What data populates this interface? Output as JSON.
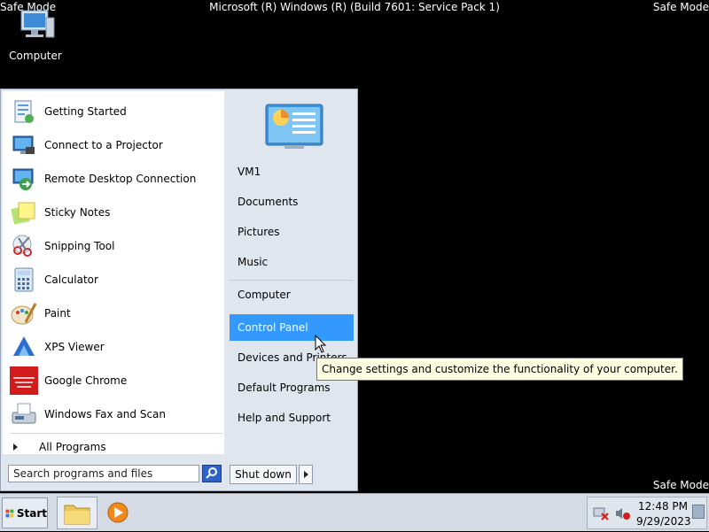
{
  "banner": {
    "top_left": "Safe Mode",
    "top_right": "Safe Mode",
    "bottom_right": "Safe Mode",
    "build": "Microsoft (R) Windows (R) (Build 7601: Service Pack 1)"
  },
  "desktop": {
    "computer_label": "Computer"
  },
  "start_menu": {
    "programs": [
      {
        "label": "Getting Started",
        "icon": "getting-started-icon"
      },
      {
        "label": "Connect to a Projector",
        "icon": "projector-icon"
      },
      {
        "label": "Remote Desktop Connection",
        "icon": "remote-desktop-icon"
      },
      {
        "label": "Sticky Notes",
        "icon": "sticky-notes-icon"
      },
      {
        "label": "Snipping Tool",
        "icon": "snipping-tool-icon"
      },
      {
        "label": "Calculator",
        "icon": "calculator-icon"
      },
      {
        "label": "Paint",
        "icon": "paint-icon"
      },
      {
        "label": "XPS Viewer",
        "icon": "xps-viewer-icon"
      },
      {
        "label": "Google Chrome",
        "icon": "chrome-icon"
      },
      {
        "label": "Windows Fax and Scan",
        "icon": "fax-scan-icon"
      }
    ],
    "all_programs": "All Programs",
    "search_placeholder": "Search programs and files",
    "right_items": [
      "VM1",
      "Documents",
      "Pictures",
      "Music",
      "Computer",
      "Control Panel",
      "Devices and Printers",
      "Default Programs",
      "Help and Support"
    ],
    "selected_item": "Control Panel",
    "shutdown_label": "Shut down",
    "tooltip": "Change settings and customize the functionality of your computer."
  },
  "taskbar": {
    "start_label": "Start",
    "clock_time": "12:48 PM",
    "clock_date": "9/29/2023"
  },
  "colors": {
    "selection": "#3399ff",
    "desktop": "#000000",
    "tooltip_bg": "#ffffe1"
  }
}
